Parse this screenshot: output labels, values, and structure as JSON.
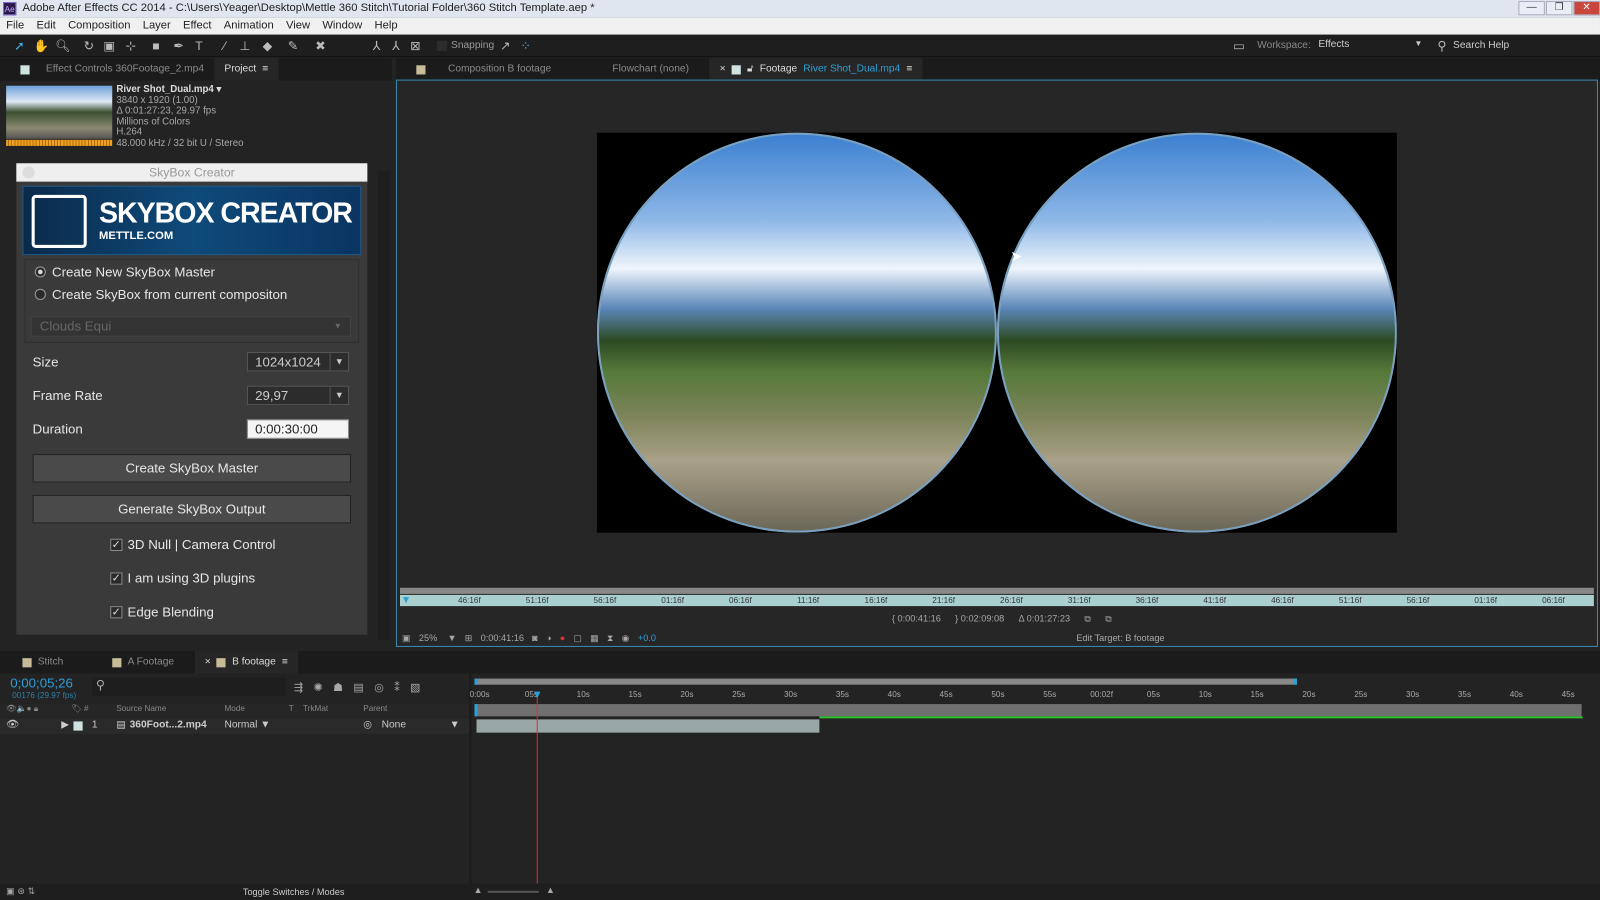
{
  "window": {
    "app_icon": "Ae",
    "title": "Adobe After Effects CC 2014 - C:\\Users\\Yeager\\Desktop\\Mettle 360 Stitch\\Tutorial Folder\\360 Stitch Template.aep *",
    "minimize": "—",
    "restore": "❐",
    "close": "✕"
  },
  "menu": [
    "File",
    "Edit",
    "Composition",
    "Layer",
    "Effect",
    "Animation",
    "View",
    "Window",
    "Help"
  ],
  "toolbar": {
    "snapping": "Snapping",
    "workspace_label": "Workspace:",
    "workspace": "Effects",
    "search_help": "Search Help"
  },
  "left_tabs": {
    "effect_controls": "Effect Controls 360Footage_2.mp4",
    "project": "Project"
  },
  "project_item": {
    "name": "River Shot_Dual.mp4",
    "lines": [
      "3840 x 1920 (1.00)",
      "Δ 0:01:27:23, 29.97 fps",
      "Millions of Colors",
      "H.264",
      "48.000 kHz / 32 bit U / Stereo"
    ]
  },
  "skybox": {
    "title": "SkyBox Creator",
    "banner_title": "SKYBOX CREATOR",
    "banner_sub": "METTLE.COM",
    "radio1": "Create New SkyBox Master",
    "radio2": "Create SkyBox from current compositon",
    "selected_radio": 1,
    "preset": "Clouds Equi",
    "size_label": "Size",
    "size": "1024x1024",
    "framerate_label": "Frame Rate",
    "framerate": "29,97",
    "duration_label": "Duration",
    "duration": "0:00:30:00",
    "btn_master": "Create SkyBox Master",
    "btn_output": "Generate SkyBox Output",
    "chk1": "3D Null | Camera Control",
    "chk2": "I am using 3D plugins",
    "chk3": "Edge Blending",
    "checked": [
      true,
      true,
      true
    ]
  },
  "viewer_tabs": {
    "composition": "Composition B footage",
    "flowchart": "Flowchart (none)",
    "footage_label": "Footage",
    "footage_name": "River Shot_Dual.mp4"
  },
  "footage_ruler": [
    "46:16f",
    "51:16f",
    "56:16f",
    "01:16f",
    "06:16f",
    "11:16f",
    "16:16f",
    "21:16f",
    "26:16f",
    "31:16f",
    "36:16f",
    "41:16f",
    "46:16f",
    "51:16f",
    "56:16f",
    "01:16f",
    "06:16f"
  ],
  "footage_times": {
    "in": "0:00:41:16",
    "out": "0:02:09:08",
    "duration": "Δ 0:01:27:23"
  },
  "viewer_bar": {
    "zoom": "25%",
    "time": "0:00:41:16",
    "exposure": "+0.0",
    "edit_target": "Edit Target: B footage"
  },
  "timeline_tabs": [
    "Stitch",
    "A Footage",
    "B footage"
  ],
  "timeline": {
    "timecode": "0;00;05;26",
    "frames": "00176 (29.97 fps)",
    "columns": {
      "source": "Source Name",
      "mode": "Mode",
      "t": "T",
      "trkmat": "TrkMat",
      "parent": "Parent"
    },
    "layer": {
      "num": "1",
      "name": "360Foot...2.mp4",
      "mode": "Normal",
      "parent": "None"
    },
    "ticks": [
      "0:00s",
      "05s",
      "10s",
      "15s",
      "20s",
      "25s",
      "30s",
      "35s",
      "40s",
      "45s",
      "50s",
      "55s",
      "00:02f",
      "05s",
      "10s",
      "15s",
      "20s",
      "25s",
      "30s",
      "35s",
      "40s",
      "45s"
    ],
    "toggle": "Toggle Switches / Modes"
  },
  "colors": {
    "accent": "#2d9fd8",
    "playhead": "#e03030",
    "work_bar": "#30c030"
  }
}
